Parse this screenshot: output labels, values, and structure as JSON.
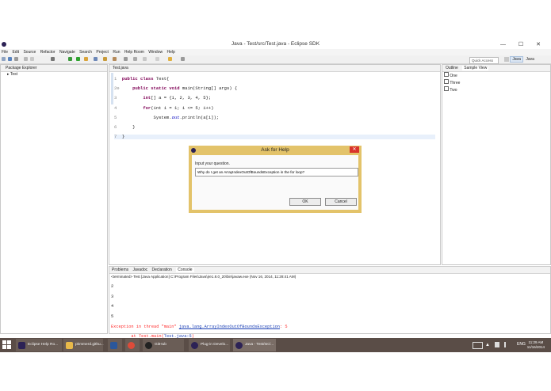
{
  "window": {
    "title": "Java - Test/src/Test.java - Eclipse SDK",
    "controls": "—  ☐  ✕"
  },
  "menu": [
    "File",
    "Edit",
    "Source",
    "Refactor",
    "Navigate",
    "Search",
    "Project",
    "Run",
    "Help Room",
    "Window",
    "Help"
  ],
  "toolbar": {
    "quick_access": "Quick Access",
    "perspectives": [
      "Java",
      "Java Browsing"
    ]
  },
  "package_explorer": {
    "tab": "Package Explorer",
    "items": [
      "Test"
    ]
  },
  "editor": {
    "tab": "Test.java",
    "lines": [
      {
        "n": "1",
        "kw": "public class ",
        "rest": "Test{"
      },
      {
        "n": "2⊖",
        "kw": "    public static void ",
        "rest": "main(String[] args) {"
      },
      {
        "n": "3",
        "kw": "        int",
        "rest": "[] a = {1, 2, 3, 4, 5};"
      },
      {
        "n": "4",
        "kw": "        for",
        "rest": "(int i = 1; i <= 5; i++)"
      },
      {
        "n": "5",
        "pre": "            System.",
        "fld": "out",
        "rest": ".println(a[i]);"
      },
      {
        "n": "6",
        "rest": "    }"
      },
      {
        "n": "7",
        "rest": "}"
      }
    ]
  },
  "outline": {
    "tabs": [
      "Outline",
      "Sample View"
    ],
    "items": [
      "One",
      "Three",
      "Two"
    ]
  },
  "console": {
    "tabs": [
      "Problems",
      "Javadoc",
      "Declaration",
      "Console"
    ],
    "header": "<terminated> Test [Java Application] C:\\Program Files\\Java\\jre1.8.0_20\\bin\\javaw.exe (Nov 16, 2014, 11:28:41 AM)",
    "output": [
      "2",
      "3",
      "4",
      "5"
    ],
    "error_prefix": "Exception in thread \"main\" ",
    "error_link": "java.lang.ArrayIndexOutOfBoundsException",
    "error_suffix": ": 5",
    "stack_prefix": "        at Test.main(",
    "stack_link": "Test.java:5",
    "stack_suffix": ")"
  },
  "dialog": {
    "title": "Ask for Help",
    "close": "✕",
    "label": "Input your question.",
    "input_value": "Why do I get an ArrayIndexOutOfBoundsException in the for loop?",
    "ok": "OK",
    "cancel": "Cancel"
  },
  "taskbar": {
    "items": [
      {
        "label": "Eclipse Help Ro...",
        "color": "#2c2255"
      },
      {
        "label": "pkmmerd.githu...",
        "color": "#e8b949"
      },
      {
        "label": "",
        "color": "#2b579a"
      },
      {
        "label": "",
        "color": "#dd4b39"
      },
      {
        "label": "GitHub",
        "color": "#222222"
      },
      {
        "label": "Plug-in Develo...",
        "color": "#2c2255"
      },
      {
        "label": "Java - Test/src/...",
        "color": "#2c2255"
      }
    ],
    "lang": "ENG",
    "time": "11:29 AM",
    "date": "11/16/2014"
  },
  "colors": {
    "dialog_frame": "#e3c36a",
    "taskbar": "#5a4d47",
    "error": "#ff2a2a",
    "keyword": "#7f0055"
  }
}
